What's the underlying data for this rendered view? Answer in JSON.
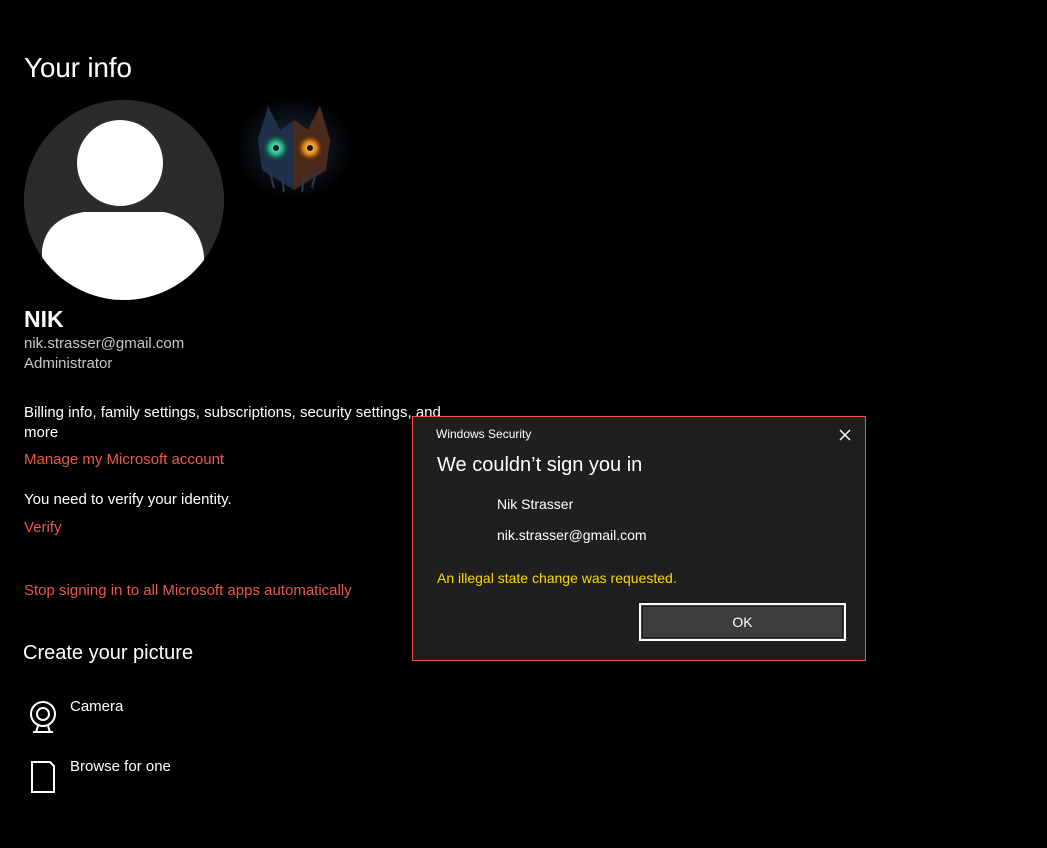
{
  "page": {
    "title": "Your info"
  },
  "profile": {
    "name": "NIK",
    "email": "nik.strasser@gmail.com",
    "role": "Administrator",
    "avatar_icon": "default-user-icon",
    "secondary_avatar_icon": "mask-picture-icon"
  },
  "account": {
    "billing_text": "Billing info, family settings, subscriptions, security settings, and more",
    "manage_link": "Manage my Microsoft account",
    "verify_text": "You need to verify your identity.",
    "verify_link": "Verify",
    "stop_link": "Stop signing in to all Microsoft apps automatically"
  },
  "picture": {
    "section_title": "Create your picture",
    "options": [
      {
        "label": "Camera",
        "icon": "camera-icon"
      },
      {
        "label": "Browse for one",
        "icon": "file-icon"
      }
    ]
  },
  "dialog": {
    "caption": "Windows Security",
    "heading": "We couldn’t sign you in",
    "user_name": "Nik Strasser",
    "user_email": "nik.strasser@gmail.com",
    "error": "An illegal state change was requested.",
    "ok_label": "OK",
    "close_icon": "close-icon"
  },
  "colors": {
    "background": "#000000",
    "link": "#e8584a",
    "dialog_bg": "#1f1f1f",
    "dialog_border": "#e8584a",
    "error_text": "#ffd700",
    "avatar_bg": "#2b2b2b"
  }
}
